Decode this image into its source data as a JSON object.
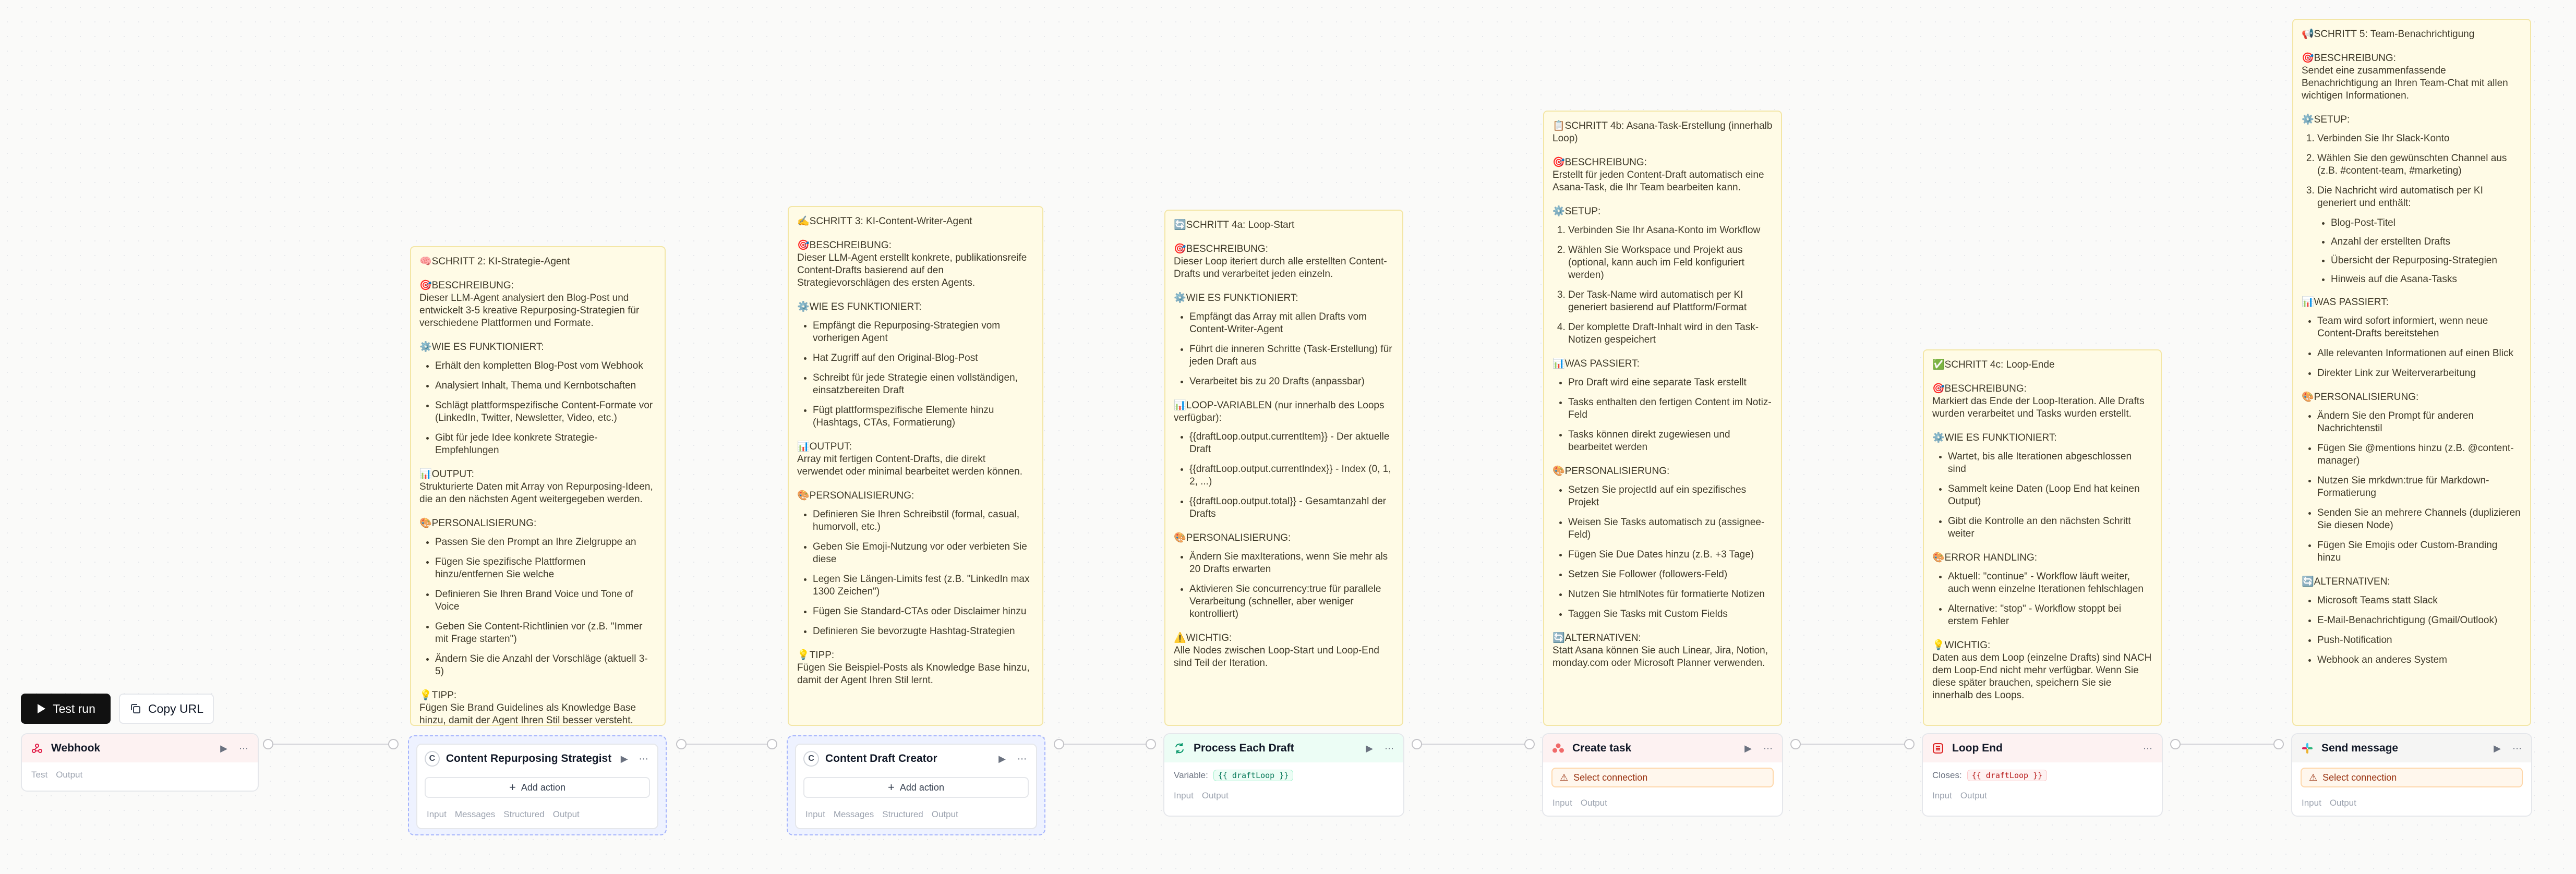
{
  "toolbar": {
    "test_run_label": "Test run",
    "copy_url_label": "Copy URL"
  },
  "notes": {
    "step2": {
      "title": "🧠SCHRITT 2: KI-Strategie-Agent",
      "desc_heading": "🎯BESCHREIBUNG:",
      "desc": "Dieser LLM-Agent analysiert den Blog-Post und entwickelt 3-5 kreative Repurposing-Strategien für verschiedene Plattformen und Formate.",
      "how_heading": "⚙️WIE ES FUNKTIONIERT:",
      "how": [
        "Erhält den kompletten Blog-Post vom Webhook",
        "Analysiert Inhalt, Thema und Kernbotschaften",
        "Schlägt plattformspezifische Content-Formate vor (LinkedIn, Twitter, Newsletter, Video, etc.)",
        "Gibt für jede Idee konkrete Strategie-Empfehlungen"
      ],
      "output_heading": "📊OUTPUT:",
      "output": "Strukturierte Daten mit Array von Repurposing-Ideen, die an den nächsten Agent weitergegeben werden.",
      "pers_heading": "🎨PERSONALISIERUNG:",
      "pers": [
        "Passen Sie den Prompt an Ihre Zielgruppe an",
        "Fügen Sie spezifische Plattformen hinzu/entfernen Sie welche",
        "Definieren Sie Ihren Brand Voice und Tone of Voice",
        "Geben Sie Content-Richtlinien vor (z.B. \"Immer mit Frage starten\")",
        "Ändern Sie die Anzahl der Vorschläge (aktuell 3-5)"
      ],
      "tip_heading": "💡TIPP:",
      "tip": "Fügen Sie Brand Guidelines als Knowledge Base hinzu, damit der Agent Ihren Stil besser versteht."
    },
    "step3": {
      "title": "✍️SCHRITT 3: KI-Content-Writer-Agent",
      "desc_heading": "🎯BESCHREIBUNG:",
      "desc": "Dieser LLM-Agent erstellt konkrete, publikationsreife Content-Drafts basierend auf den Strategievorschlägen des ersten Agents.",
      "how_heading": "⚙️WIE ES FUNKTIONIERT:",
      "how": [
        "Empfängt die Repurposing-Strategien vom vorherigen Agent",
        "Hat Zugriff auf den Original-Blog-Post",
        "Schreibt für jede Strategie einen vollständigen, einsatzbereiten Draft",
        "Fügt plattformspezifische Elemente hinzu (Hashtags, CTAs, Formatierung)"
      ],
      "output_heading": "📊OUTPUT:",
      "output": "Array mit fertigen Content-Drafts, die direkt verwendet oder minimal bearbeitet werden können.",
      "pers_heading": "🎨PERSONALISIERUNG:",
      "pers": [
        "Definieren Sie Ihren Schreibstil (formal, casual, humorvoll, etc.)",
        "Geben Sie Emoji-Nutzung vor oder verbieten Sie diese",
        "Legen Sie Längen-Limits fest (z.B. \"LinkedIn max 1300 Zeichen\")",
        "Fügen Sie Standard-CTAs oder Disclaimer hinzu",
        "Definieren Sie bevorzugte Hashtag-Strategien"
      ],
      "tip_heading": "💡TIPP:",
      "tip": "Fügen Sie Beispiel-Posts als Knowledge Base hinzu, damit der Agent Ihren Stil lernt."
    },
    "step4a": {
      "title": "🔄SCHRITT 4a: Loop-Start",
      "desc_heading": "🎯BESCHREIBUNG:",
      "desc": "Dieser Loop iteriert durch alle erstellten Content-Drafts und verarbeitet jeden einzeln.",
      "how_heading": "⚙️WIE ES FUNKTIONIERT:",
      "how": [
        "Empfängt das Array mit allen Drafts vom Content-Writer-Agent",
        "Führt die inneren Schritte (Task-Erstellung) für jeden Draft aus",
        "Verarbeitet bis zu 20 Drafts (anpassbar)"
      ],
      "vars_heading": "📊LOOP-VARIABLEN (nur innerhalb des Loops verfügbar):",
      "vars": [
        "{{draftLoop.output.currentItem}} - Der aktuelle Draft",
        "{{draftLoop.output.currentIndex}} - Index (0, 1, 2, ...)",
        "{{draftLoop.output.total}} - Gesamtanzahl der Drafts"
      ],
      "pers_heading": "🎨PERSONALISIERUNG:",
      "pers": [
        "Ändern Sie maxIterations, wenn Sie mehr als 20 Drafts erwarten",
        "Aktivieren Sie concurrency:true für parallele Verarbeitung (schneller, aber weniger kontrolliert)"
      ],
      "warn_heading": "⚠️WICHTIG:",
      "warn": "Alle Nodes zwischen Loop-Start und Loop-End sind Teil der Iteration."
    },
    "step4b": {
      "title": "📋SCHRITT 4b: Asana-Task-Erstellung (innerhalb Loop)",
      "desc_heading": "🎯BESCHREIBUNG:",
      "desc": "Erstellt für jeden Content-Draft automatisch eine Asana-Task, die Ihr Team bearbeiten kann.",
      "setup_heading": "⚙️SETUP:",
      "setup": [
        "Verbinden Sie Ihr Asana-Konto im Workflow",
        "Wählen Sie Workspace und Projekt aus (optional, kann auch im Feld konfiguriert werden)",
        "Der Task-Name wird automatisch per KI generiert basierend auf Plattform/Format",
        "Der komplette Draft-Inhalt wird in den Task-Notizen gespeichert"
      ],
      "what_heading": "📊WAS PASSIERT:",
      "what": [
        "Pro Draft wird eine separate Task erstellt",
        "Tasks enthalten den fertigen Content im Notiz-Feld",
        "Tasks können direkt zugewiesen und bearbeitet werden"
      ],
      "pers_heading": "🎨PERSONALISIERUNG:",
      "pers": [
        "Setzen Sie projectId auf ein spezifisches Projekt",
        "Weisen Sie Tasks automatisch zu (assignee-Feld)",
        "Fügen Sie Due Dates hinzu (z.B. +3 Tage)",
        "Setzen Sie Follower (followers-Feld)",
        "Nutzen Sie htmlNotes für formatierte Notizen",
        "Taggen Sie Tasks mit Custom Fields"
      ],
      "alt_heading": "🔄ALTERNATIVEN:",
      "alt": "Statt Asana können Sie auch Linear, Jira, Notion, monday.com oder Microsoft Planner verwenden."
    },
    "step4c": {
      "title": "✅SCHRITT 4c: Loop-Ende",
      "desc_heading": "🎯BESCHREIBUNG:",
      "desc": "Markiert das Ende der Loop-Iteration. Alle Drafts wurden verarbeitet und Tasks wurden erstellt.",
      "how_heading": "⚙️WIE ES FUNKTIONIERT:",
      "how": [
        "Wartet, bis alle Iterationen abgeschlossen sind",
        "Sammelt keine Daten (Loop End hat keinen Output)",
        "Gibt die Kontrolle an den nächsten Schritt weiter"
      ],
      "err_heading": "🎨ERROR HANDLING:",
      "err": [
        "Aktuell: \"continue\" - Workflow läuft weiter, auch wenn einzelne Iterationen fehlschlagen",
        "Alternative: \"stop\" - Workflow stoppt bei erstem Fehler"
      ],
      "tip_heading": "💡WICHTIG:",
      "tip": "Daten aus dem Loop (einzelne Drafts) sind NACH dem Loop-End nicht mehr verfügbar. Wenn Sie diese später brauchen, speichern Sie sie innerhalb des Loops."
    },
    "step5": {
      "title": "📢SCHRITT 5: Team-Benachrichtigung",
      "desc_heading": "🎯BESCHREIBUNG:",
      "desc": "Sendet eine zusammenfassende Benachrichtigung an Ihren Team-Chat mit allen wichtigen Informationen.",
      "setup_heading": "⚙️SETUP:",
      "setup": [
        "Verbinden Sie Ihr Slack-Konto",
        "Wählen Sie den gewünschten Channel aus (z.B. #content-team, #marketing)",
        "Die Nachricht wird automatisch per KI generiert und enthält:"
      ],
      "setup_sub": [
        "Blog-Post-Titel",
        "Anzahl der erstellten Drafts",
        "Übersicht der Repurposing-Strategien",
        "Hinweis auf die Asana-Tasks"
      ],
      "what_heading": "📊WAS PASSIERT:",
      "what": [
        "Team wird sofort informiert, wenn neue Content-Drafts bereitstehen",
        "Alle relevanten Informationen auf einen Blick",
        "Direkter Link zur Weiterverarbeitung"
      ],
      "pers_heading": "🎨PERSONALISIERUNG:",
      "pers": [
        "Ändern Sie den Prompt für anderen Nachrichtenstil",
        "Fügen Sie @mentions hinzu (z.B. @content-manager)",
        "Nutzen Sie mrkdwn:true für Markdown-Formatierung",
        "Senden Sie an mehrere Channels (duplizieren Sie diesen Node)",
        "Fügen Sie Emojis oder Custom-Branding hinzu"
      ],
      "alt_heading": "🔄ALTERNATIVEN:",
      "alt": [
        "Microsoft Teams statt Slack",
        "E-Mail-Benachrichtigung (Gmail/Outlook)",
        "Push-Notification",
        "Webhook an anderes System"
      ]
    }
  },
  "nodes": {
    "webhook": {
      "title": "Webhook",
      "tabs": [
        "Test",
        "Output"
      ]
    },
    "strategist": {
      "title": "Content Repurposing Strategist",
      "add_action": "Add action",
      "tabs": [
        "Input",
        "Messages",
        "Structured",
        "Output"
      ]
    },
    "writer": {
      "title": "Content Draft Creator",
      "add_action": "Add action",
      "tabs": [
        "Input",
        "Messages",
        "Structured",
        "Output"
      ]
    },
    "loop_start": {
      "title": "Process Each Draft",
      "var_label": "Variable:",
      "var_value": "{{ draftLoop }}",
      "tabs": [
        "Input",
        "Output"
      ]
    },
    "asana": {
      "title": "Create task",
      "warning": "Select connection",
      "tabs": [
        "Input",
        "Output"
      ]
    },
    "loop_end": {
      "title": "Loop End",
      "closes_label": "Closes:",
      "closes_value": "{{ draftLoop }}",
      "tabs": [
        "Input",
        "Output"
      ]
    },
    "slack": {
      "title": "Send message",
      "warning": "Select connection",
      "tabs": [
        "Input",
        "Output"
      ]
    }
  },
  "colors": {
    "note_bg": "#fffbe6",
    "note_border": "#f3e6a6",
    "agent_border": "#a5b4fc",
    "webhook_header": "#fdf2f2",
    "loop_header": "#ecfdf5",
    "asana_accent": "#f06a6a",
    "warning_bg": "#fff7ed"
  }
}
